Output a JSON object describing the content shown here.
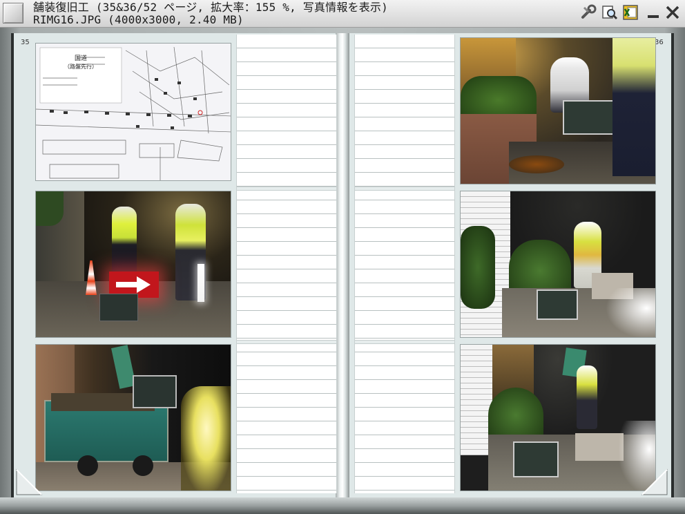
{
  "window": {
    "title_line1": "舗装復旧工 (35&36/52 ページ, 拡大率：155 %, 写真情報を表示)",
    "title_line2": "RIMG16.JPG (4000x3000, 2.40 MB)"
  },
  "toolbar": {
    "icons": [
      "tools-icon",
      "magnifier-icon",
      "excel-icon",
      "minimize-icon",
      "close-icon"
    ]
  },
  "pages": {
    "left_number": "35",
    "right_number": "36"
  },
  "map": {
    "title": "国道",
    "subtitle": "（路盤先行）"
  },
  "colors": {
    "frame": "#b9bfbf",
    "page": "#dfe8e8",
    "memo": "#ffffff",
    "sign_red": "#d8242a",
    "vest_yellow": "#d8f040"
  }
}
